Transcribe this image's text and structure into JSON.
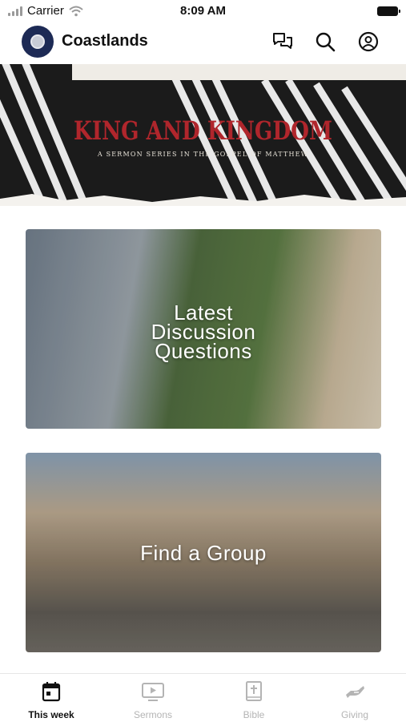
{
  "status_bar": {
    "carrier": "Carrier",
    "time": "8:09 AM"
  },
  "header": {
    "title": "Coastlands",
    "icons": [
      "chat-icon",
      "search-icon",
      "profile-icon"
    ]
  },
  "banner": {
    "title": "KING AND KINGDOM",
    "subtitle": "A SERMON SERIES IN THE GOSPEL OF MATTHEW",
    "accent_color": "#b0262c"
  },
  "cards": [
    {
      "label_lines": [
        "Latest",
        "Discussion",
        "Questions"
      ]
    },
    {
      "label": "Find a Group"
    }
  ],
  "tabs": [
    {
      "label": "This week",
      "icon": "calendar-icon",
      "active": true
    },
    {
      "label": "Sermons",
      "icon": "video-icon",
      "active": false
    },
    {
      "label": "Bible",
      "icon": "bible-icon",
      "active": false
    },
    {
      "label": "Giving",
      "icon": "giving-icon",
      "active": false
    }
  ]
}
